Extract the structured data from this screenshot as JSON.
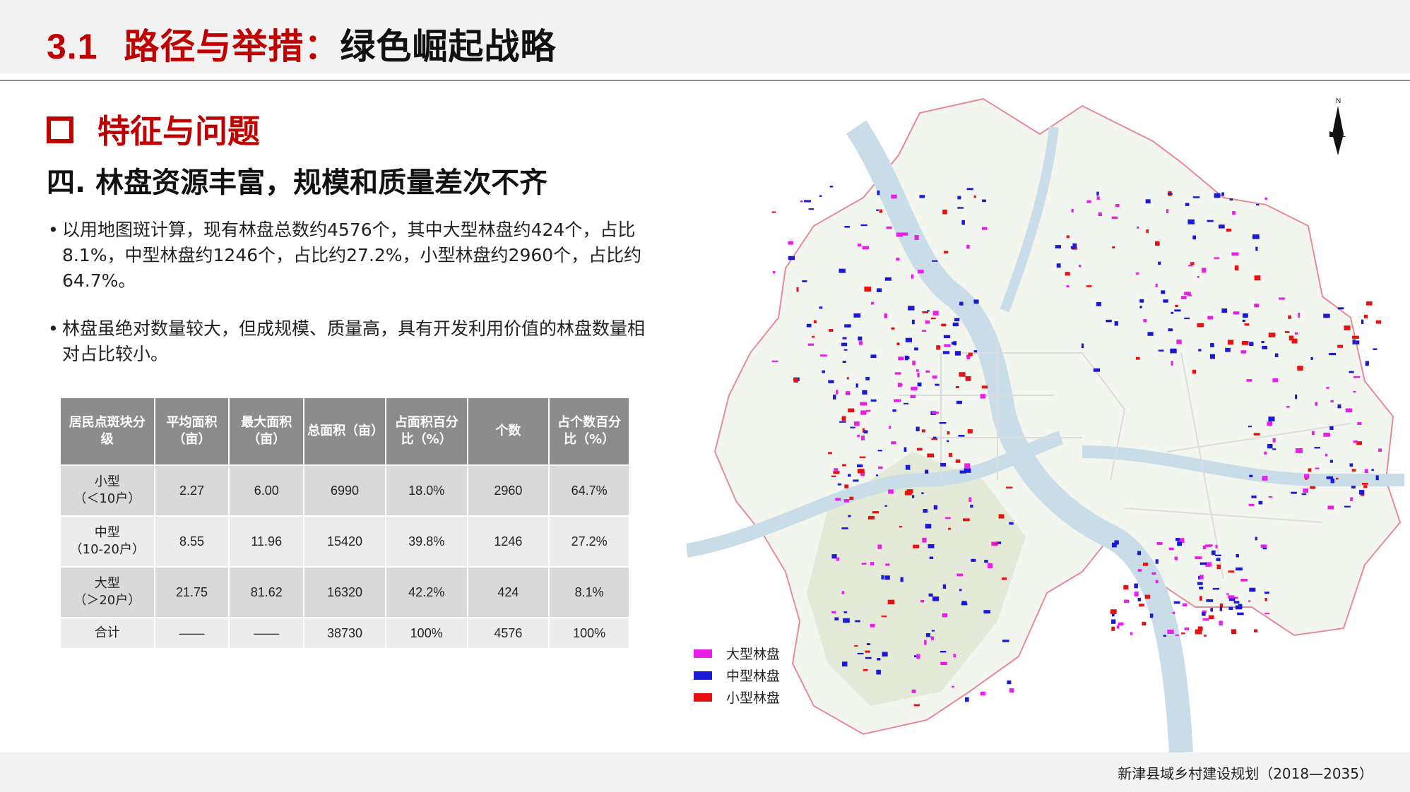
{
  "header": {
    "number": "3.1",
    "title_red": "路径与举措：",
    "title_black": "绿色崛起战略"
  },
  "section": {
    "title": "特征与问题"
  },
  "subtitle": "四. 林盘资源丰富，规模和质量差次不齐",
  "bullets": [
    "以用地图斑计算，现有林盘总数约4576个，其中大型林盘约424个，占比8.1%，中型林盘约1246个，占比约27.2%，小型林盘约2960个，占比约64.7%。",
    "林盘虽绝对数量较大，但成规模、质量高，具有开发利用价值的林盘数量相对占比较小。"
  ],
  "table": {
    "headers": [
      "居民点斑块分级",
      "平均面积（亩）",
      "最大面积（亩）",
      "总面积（亩）",
      "占面积百分比（%）",
      "个数",
      "占个数百分比（%）"
    ],
    "rows": [
      {
        "name": "小型",
        "sub": "（＜10户）",
        "avg": "2.27",
        "max": "6.00",
        "total": "6990",
        "area_pct": "18.0%",
        "count": "2960",
        "count_pct": "64.7%"
      },
      {
        "name": "中型",
        "sub": "（10-20户）",
        "avg": "8.55",
        "max": "11.96",
        "total": "15420",
        "area_pct": "39.8%",
        "count": "1246",
        "count_pct": "27.2%"
      },
      {
        "name": "大型",
        "sub": "（＞20户）",
        "avg": "21.75",
        "max": "81.62",
        "total": "16320",
        "area_pct": "42.2%",
        "count": "424",
        "count_pct": "8.1%"
      }
    ],
    "total": {
      "name": "合计",
      "avg": "——",
      "max": "——",
      "total": "38730",
      "area_pct": "100%",
      "count": "4576",
      "count_pct": "100%"
    }
  },
  "map": {
    "north_label": "N",
    "legend": [
      {
        "label": "大型林盘",
        "color": "#e91ee9"
      },
      {
        "label": "中型林盘",
        "color": "#1a1ad6"
      },
      {
        "label": "小型林盘",
        "color": "#e81010"
      }
    ]
  },
  "footer": "新津县域乡村建设规划（2018—2035）"
}
